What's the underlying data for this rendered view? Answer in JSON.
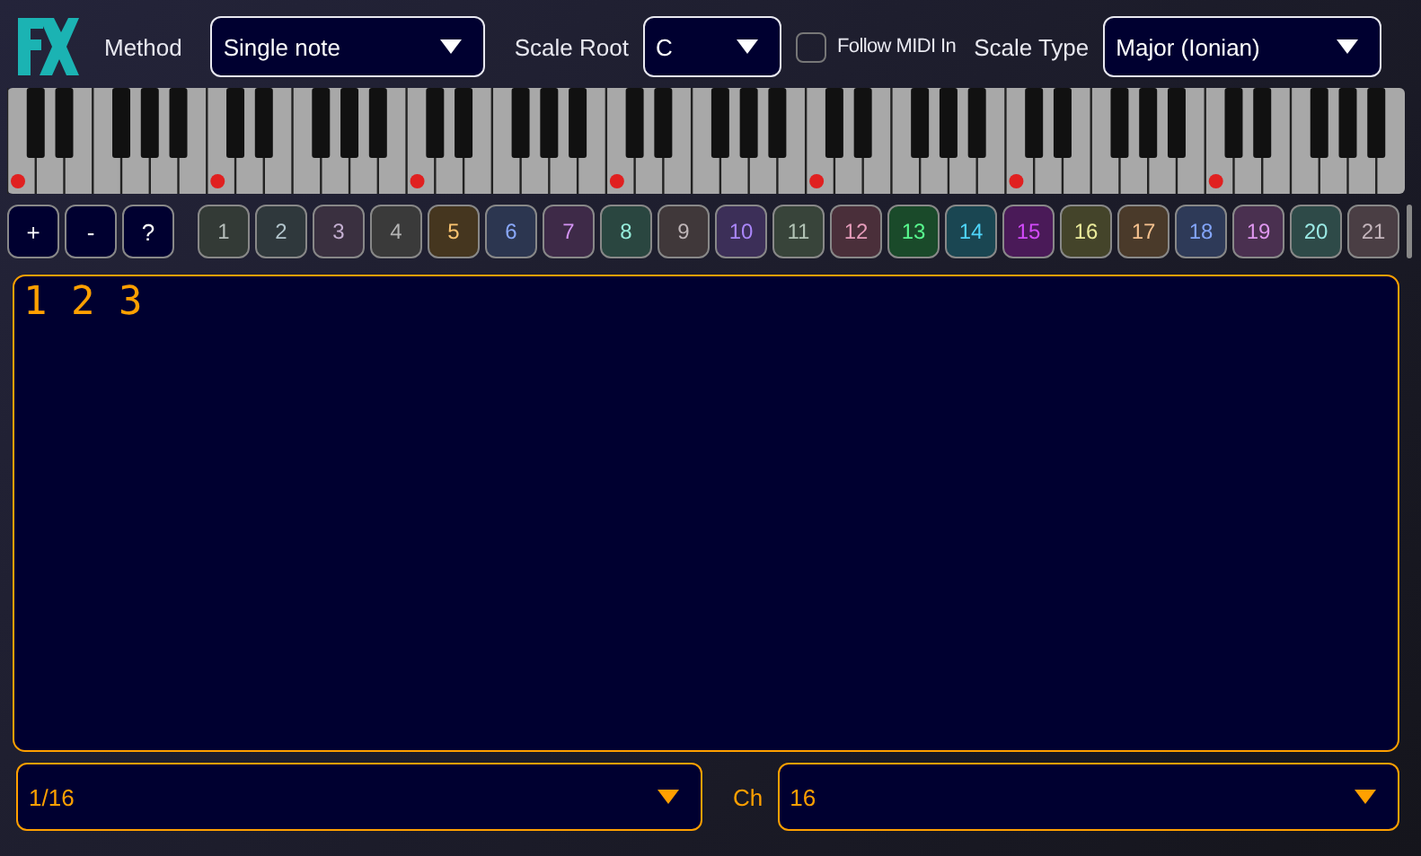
{
  "toolbar": {
    "method_label": "Method",
    "method": {
      "value": "Single note"
    },
    "scale_root_label": "Scale Root",
    "scale_root": {
      "value": "C"
    },
    "follow_midi": {
      "label": "Follow MIDI In",
      "checked": false
    },
    "scale_type_label": "Scale Type",
    "scale_type": {
      "value": "Major (Ionian)"
    }
  },
  "actions": [
    "+",
    "-",
    "?"
  ],
  "patterns": [
    {
      "label": "1",
      "color": "#333a36",
      "selected": false
    },
    {
      "label": "2",
      "color": "#2f383c",
      "selected": false
    },
    {
      "label": "3",
      "color": "#3a3040",
      "selected": false
    },
    {
      "label": "4",
      "color": "#3a3a3a",
      "selected": false
    },
    {
      "label": "5",
      "color": "#45361f",
      "selected": false
    },
    {
      "label": "6",
      "color": "#2c3650",
      "selected": false
    },
    {
      "label": "7",
      "color": "#3e2a48",
      "selected": false
    },
    {
      "label": "8",
      "color": "#2a4640",
      "selected": false
    },
    {
      "label": "9",
      "color": "#40383a",
      "selected": false
    },
    {
      "label": "10",
      "color": "#3c2f58",
      "selected": false
    },
    {
      "label": "11",
      "color": "#38443a",
      "selected": false
    },
    {
      "label": "12",
      "color": "#4a2f3a",
      "selected": false
    },
    {
      "label": "13",
      "color": "#1a4a2a",
      "selected": false
    },
    {
      "label": "14",
      "color": "#1a4652",
      "selected": false
    },
    {
      "label": "15",
      "color": "#4a1a58",
      "selected": false
    },
    {
      "label": "16",
      "color": "#44442a",
      "selected": false
    },
    {
      "label": "17",
      "color": "#4a3a2a",
      "selected": false
    },
    {
      "label": "18",
      "color": "#2e3a58",
      "selected": false
    },
    {
      "label": "19",
      "color": "#4a3050",
      "selected": false
    },
    {
      "label": "20",
      "color": "#2e4a48",
      "selected": false
    },
    {
      "label": "21",
      "color": "#4a3e44",
      "selected": false
    }
  ],
  "editor": {
    "value": "1 2 3"
  },
  "footer": {
    "division": {
      "value": "1/16"
    },
    "channel_label": "Ch",
    "channel": {
      "value": "16"
    }
  }
}
